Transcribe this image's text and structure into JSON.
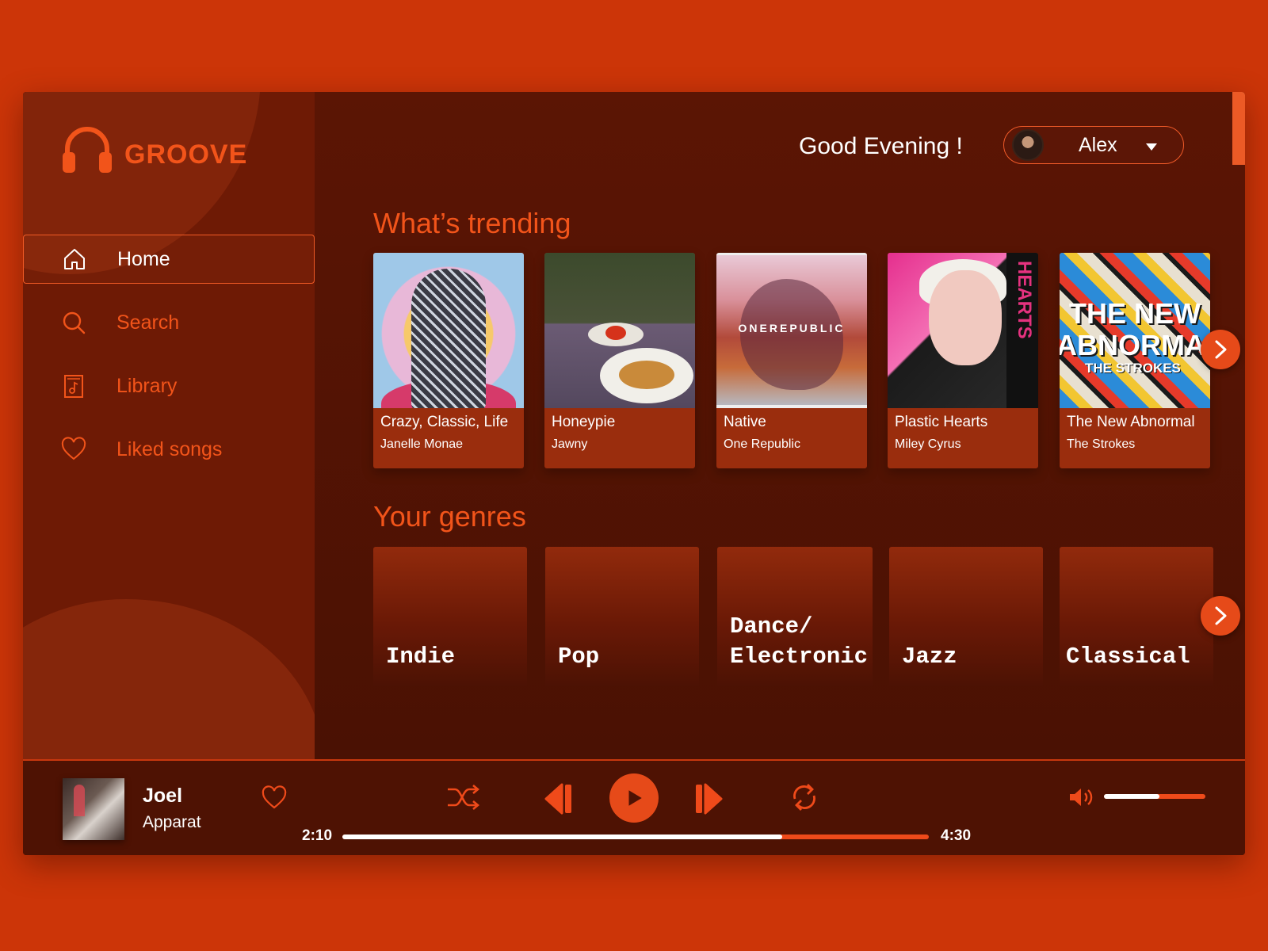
{
  "brand": {
    "name": "GROOVE",
    "color": "#f2541a"
  },
  "sidebar": {
    "items": [
      {
        "label": "Home",
        "icon": "home-icon",
        "active": true
      },
      {
        "label": "Search",
        "icon": "search-icon",
        "active": false
      },
      {
        "label": "Library",
        "icon": "library-icon",
        "active": false
      },
      {
        "label": "Liked songs",
        "icon": "heart-icon",
        "active": false
      }
    ]
  },
  "header": {
    "greeting": "Good Evening !",
    "user": {
      "name": "Alex"
    }
  },
  "trending": {
    "title": "What’s trending",
    "items": [
      {
        "title": "Crazy, Classic, Life",
        "artist": "Janelle Monae"
      },
      {
        "title": "Honeypie",
        "artist": "Jawny"
      },
      {
        "title": "Native",
        "artist": "One Republic",
        "cover_text": "ONEREPUBLIC"
      },
      {
        "title": "Plastic Hearts",
        "artist": "Miley Cyrus",
        "cover_text": "PLASTIC HEARTS"
      },
      {
        "title": "The New Abnormal",
        "artist": "The Strokes",
        "cover_text": [
          "THE NEW",
          "ABNORMAL",
          "THE STROKES"
        ]
      }
    ]
  },
  "genres": {
    "title": "Your genres",
    "items": [
      "Indie",
      "Pop",
      "Dance/\nElectronic",
      "Jazz",
      "Classical"
    ]
  },
  "player": {
    "track": {
      "title": "Joel",
      "artist": "Apparat"
    },
    "current_time": "2:10",
    "total_time": "4:30",
    "progress": 0.75,
    "volume": 0.55
  },
  "colors": {
    "accent": "#e64a19",
    "background": "#cc3508",
    "panel": "#4a1103"
  }
}
